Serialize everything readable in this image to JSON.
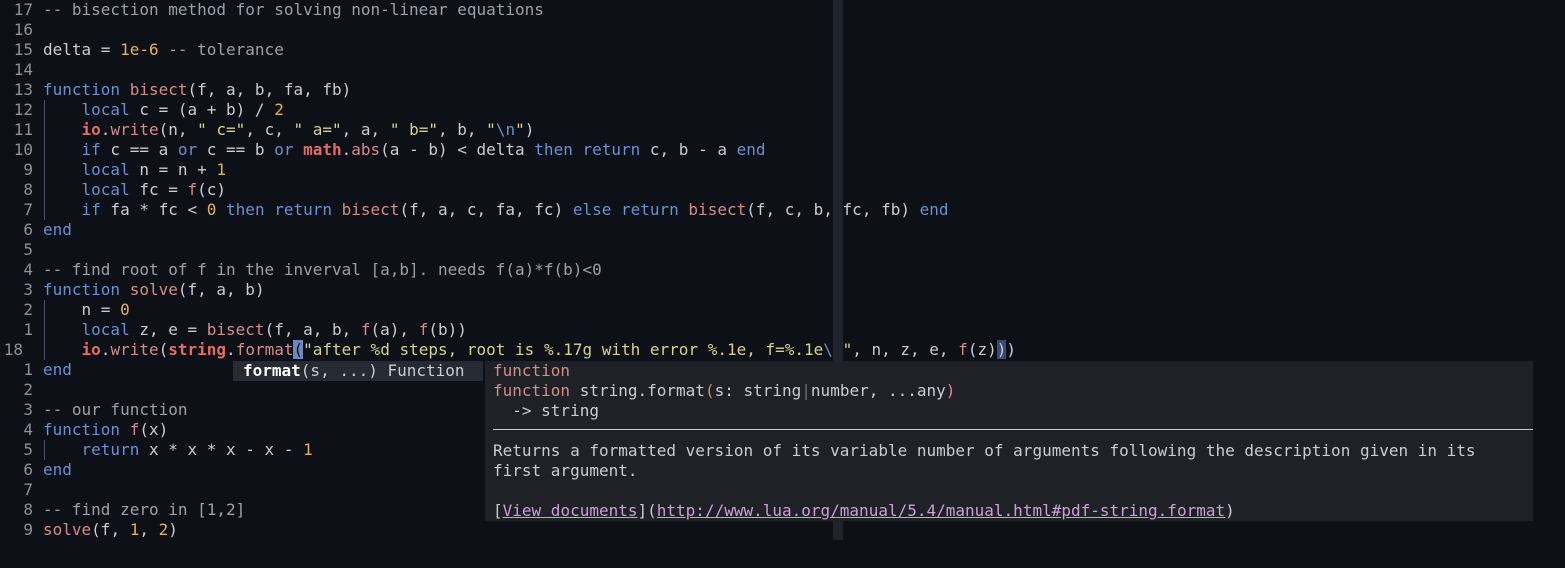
{
  "editor": {
    "lines": [
      {
        "ln": "17",
        "segs": [
          {
            "t": "-- bisection method for solving non-linear equations",
            "c": "cm"
          }
        ]
      },
      {
        "ln": "16",
        "segs": []
      },
      {
        "ln": "15",
        "segs": [
          {
            "t": "delta = ",
            "c": "id"
          },
          {
            "t": "1e-6",
            "c": "num"
          },
          {
            "t": " -- tolerance",
            "c": "cm"
          }
        ]
      },
      {
        "ln": "14",
        "segs": []
      },
      {
        "ln": "13",
        "segs": [
          {
            "t": "function ",
            "c": "kw"
          },
          {
            "t": "bisect",
            "c": "fn"
          },
          {
            "t": "(f, a, b, fa, fb)",
            "c": "id"
          }
        ]
      },
      {
        "ln": "12",
        "indent": true,
        "segs": [
          {
            "t": "    local",
            "c": "kw"
          },
          {
            "t": " c = (a + b) / ",
            "c": "id"
          },
          {
            "t": "2",
            "c": "num"
          }
        ]
      },
      {
        "ln": "11",
        "indent": true,
        "segs": [
          {
            "t": "    ",
            "c": "id"
          },
          {
            "t": "io",
            "c": "lib"
          },
          {
            "t": ".",
            "c": "id"
          },
          {
            "t": "write",
            "c": "fn"
          },
          {
            "t": "(n, ",
            "c": "id"
          },
          {
            "t": "\" c=\"",
            "c": "str"
          },
          {
            "t": ", c, ",
            "c": "id"
          },
          {
            "t": "\" a=\"",
            "c": "str"
          },
          {
            "t": ", a, ",
            "c": "id"
          },
          {
            "t": "\" b=\"",
            "c": "str"
          },
          {
            "t": ", b, ",
            "c": "id"
          },
          {
            "t": "\"",
            "c": "str"
          },
          {
            "t": "\\n",
            "c": "esc"
          },
          {
            "t": "\"",
            "c": "str"
          },
          {
            "t": ")",
            "c": "id"
          }
        ]
      },
      {
        "ln": "10",
        "indent": true,
        "segs": [
          {
            "t": "    if",
            "c": "kw"
          },
          {
            "t": " c == a ",
            "c": "id"
          },
          {
            "t": "or",
            "c": "kw"
          },
          {
            "t": " c == b ",
            "c": "id"
          },
          {
            "t": "or",
            "c": "kw"
          },
          {
            "t": " ",
            "c": "id"
          },
          {
            "t": "math",
            "c": "lib"
          },
          {
            "t": ".",
            "c": "id"
          },
          {
            "t": "abs",
            "c": "fn"
          },
          {
            "t": "(a - b) < delta ",
            "c": "id"
          },
          {
            "t": "then return",
            "c": "kw"
          },
          {
            "t": " c, b - a ",
            "c": "id"
          },
          {
            "t": "end",
            "c": "kw"
          }
        ]
      },
      {
        "ln": "9",
        "indent": true,
        "segs": [
          {
            "t": "    local",
            "c": "kw"
          },
          {
            "t": " n = n + ",
            "c": "id"
          },
          {
            "t": "1",
            "c": "num"
          }
        ]
      },
      {
        "ln": "8",
        "indent": true,
        "segs": [
          {
            "t": "    local",
            "c": "kw"
          },
          {
            "t": " fc = ",
            "c": "id"
          },
          {
            "t": "f",
            "c": "fn"
          },
          {
            "t": "(c)",
            "c": "id"
          }
        ]
      },
      {
        "ln": "7",
        "indent": true,
        "segs": [
          {
            "t": "    if",
            "c": "kw"
          },
          {
            "t": " fa * fc < ",
            "c": "id"
          },
          {
            "t": "0",
            "c": "num"
          },
          {
            "t": " then return ",
            "c": "kw"
          },
          {
            "t": "bisect",
            "c": "fn"
          },
          {
            "t": "(f, a, c, fa, fc) ",
            "c": "id"
          },
          {
            "t": "else return ",
            "c": "kw"
          },
          {
            "t": "bisect",
            "c": "fn"
          },
          {
            "t": "(f, c, b, fc, fb) ",
            "c": "id"
          },
          {
            "t": "end",
            "c": "kw"
          }
        ]
      },
      {
        "ln": "6",
        "segs": [
          {
            "t": "end",
            "c": "kw"
          }
        ]
      },
      {
        "ln": "5",
        "segs": []
      },
      {
        "ln": "4",
        "segs": [
          {
            "t": "-- find root of f in the inverval [a,b]. needs f(a)*f(b)<0",
            "c": "cm"
          }
        ]
      },
      {
        "ln": "3",
        "segs": [
          {
            "t": "function ",
            "c": "kw"
          },
          {
            "t": "solve",
            "c": "fn"
          },
          {
            "t": "(f, a, b)",
            "c": "id"
          }
        ]
      },
      {
        "ln": "2",
        "indent": true,
        "segs": [
          {
            "t": "    n = ",
            "c": "id"
          },
          {
            "t": "0",
            "c": "num"
          }
        ]
      },
      {
        "ln": "1",
        "indent": true,
        "segs": [
          {
            "t": "    local",
            "c": "kw"
          },
          {
            "t": " z, e = ",
            "c": "id"
          },
          {
            "t": "bisect",
            "c": "fn"
          },
          {
            "t": "(f, a, b, ",
            "c": "id"
          },
          {
            "t": "f",
            "c": "fn"
          },
          {
            "t": "(a), ",
            "c": "id"
          },
          {
            "t": "f",
            "c": "fn"
          },
          {
            "t": "(b))",
            "c": "id"
          }
        ]
      },
      {
        "ln": "18",
        "current": true,
        "indent": true,
        "segs": [
          {
            "t": "    ",
            "c": "id"
          },
          {
            "t": "io",
            "c": "lib"
          },
          {
            "t": ".",
            "c": "id"
          },
          {
            "t": "write",
            "c": "fn"
          },
          {
            "t": "(",
            "c": "id"
          },
          {
            "t": "string",
            "c": "lib"
          },
          {
            "t": ".",
            "c": "id"
          },
          {
            "t": "format",
            "c": "fn"
          },
          {
            "t": "(",
            "c": "cursor-ch"
          },
          {
            "t": "\"after %d steps, root is %.17g with error %.1e, f=%.1e",
            "c": "str"
          },
          {
            "t": "\\n",
            "c": "esc"
          },
          {
            "t": "\"",
            "c": "str"
          },
          {
            "t": ", n, z, e, ",
            "c": "id"
          },
          {
            "t": "f",
            "c": "fn"
          },
          {
            "t": "(z)",
            "c": "id"
          },
          {
            "t": ")",
            "c": "paren-hl"
          },
          {
            "t": ")",
            "c": "id"
          }
        ]
      },
      {
        "ln": "1",
        "segs": [
          {
            "t": "end",
            "c": "kw"
          }
        ]
      },
      {
        "ln": "2",
        "segs": []
      },
      {
        "ln": "3",
        "segs": [
          {
            "t": "-- our function",
            "c": "cm"
          }
        ]
      },
      {
        "ln": "4",
        "segs": [
          {
            "t": "function ",
            "c": "kw"
          },
          {
            "t": "f",
            "c": "fn"
          },
          {
            "t": "(x)",
            "c": "id"
          }
        ]
      },
      {
        "ln": "5",
        "indent": true,
        "segs": [
          {
            "t": "    return",
            "c": "kw"
          },
          {
            "t": " x * x * x - x - ",
            "c": "id"
          },
          {
            "t": "1",
            "c": "num"
          }
        ]
      },
      {
        "ln": "6",
        "segs": [
          {
            "t": "end",
            "c": "kw"
          }
        ]
      },
      {
        "ln": "7",
        "segs": []
      },
      {
        "ln": "8",
        "segs": [
          {
            "t": "-- find zero in [1,2]",
            "c": "cm"
          }
        ]
      },
      {
        "ln": "9",
        "segs": [
          {
            "t": "solve",
            "c": "fn"
          },
          {
            "t": "(f, ",
            "c": "id"
          },
          {
            "t": "1",
            "c": "num"
          },
          {
            "t": ", ",
            "c": "id"
          },
          {
            "t": "2",
            "c": "num"
          },
          {
            "t": ")",
            "c": "id"
          }
        ]
      }
    ]
  },
  "signature_hint": {
    "name": "format",
    "args": "(s, ...)",
    "kind": "Function"
  },
  "doc_popup": {
    "kind_label": "function",
    "signature_prefix": "function ",
    "signature_name": "string.format",
    "signature_open": "(",
    "signature_params_a": "s: string",
    "signature_pipe": "|",
    "signature_params_b": "number, ...any",
    "signature_close": ")",
    "returns": "  -> string",
    "desc_line1": "Returns a formatted version of its variable number of arguments following the description given in its",
    "desc_line2": "first argument.",
    "link_open": "[",
    "link_text": "View documents",
    "link_mid": "](",
    "link_url": "http://www.lua.org/manual/5.4/manual.html#pdf-string.format",
    "link_close": ")"
  }
}
